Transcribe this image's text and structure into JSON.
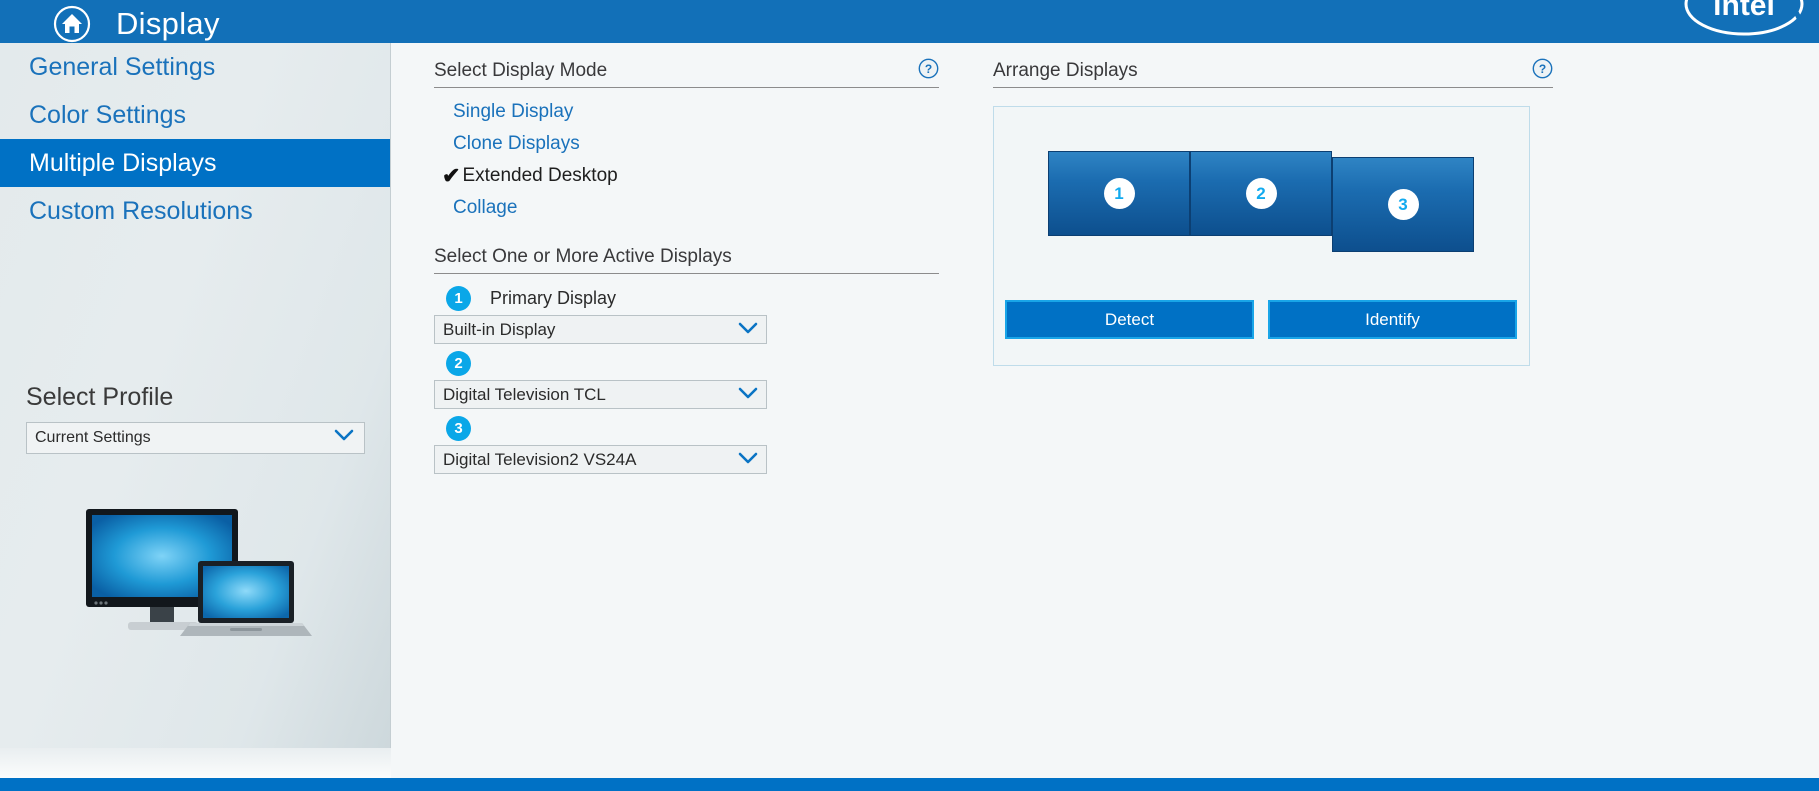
{
  "titlebar": {
    "home_icon": "home-icon",
    "title": "Display",
    "brand_logo": "intel-logo",
    "brand_text": "intel",
    "bar_color": "#1270b8"
  },
  "sidebar": {
    "items": [
      {
        "label": "General Settings",
        "selected": false
      },
      {
        "label": "Color Settings",
        "selected": false
      },
      {
        "label": "Multiple Displays",
        "selected": true
      },
      {
        "label": "Custom Resolutions",
        "selected": false
      }
    ],
    "profile": {
      "label": "Select Profile",
      "selected_value": "Current Settings",
      "chevron_icon": "chevron-down-icon"
    },
    "illustration": "monitor-and-laptop-illustration",
    "selected_color": "#0071c5",
    "link_color": "#1a72bb"
  },
  "display_mode": {
    "heading": "Select Display Mode",
    "help_icon": "help-circle-icon",
    "options": [
      {
        "label": "Single Display",
        "active": false
      },
      {
        "label": "Clone Displays",
        "active": false
      },
      {
        "label": "Extended Desktop",
        "active": true
      },
      {
        "label": "Collage",
        "active": false
      }
    ],
    "checkmark": "✔"
  },
  "active_displays": {
    "heading": "Select One or More Active Displays",
    "rows": [
      {
        "badge": "1",
        "badge_label": "Primary Display",
        "value": "Built-in Display"
      },
      {
        "badge": "2",
        "badge_label": "",
        "value": "Digital Television TCL"
      },
      {
        "badge": "3",
        "badge_label": "",
        "value": "Digital Television2 VS24A"
      }
    ],
    "chevron_icon": "chevron-down-icon",
    "badge_color": "#0aa7e8"
  },
  "arrange": {
    "heading": "Arrange Displays",
    "help_icon": "help-circle-icon",
    "monitors": [
      {
        "number": "1"
      },
      {
        "number": "2"
      },
      {
        "number": "3"
      }
    ],
    "buttons": [
      {
        "label": "Detect"
      },
      {
        "label": "Identify"
      }
    ],
    "button_color": "#0071c5",
    "button_border_color": "#19a5e8"
  }
}
